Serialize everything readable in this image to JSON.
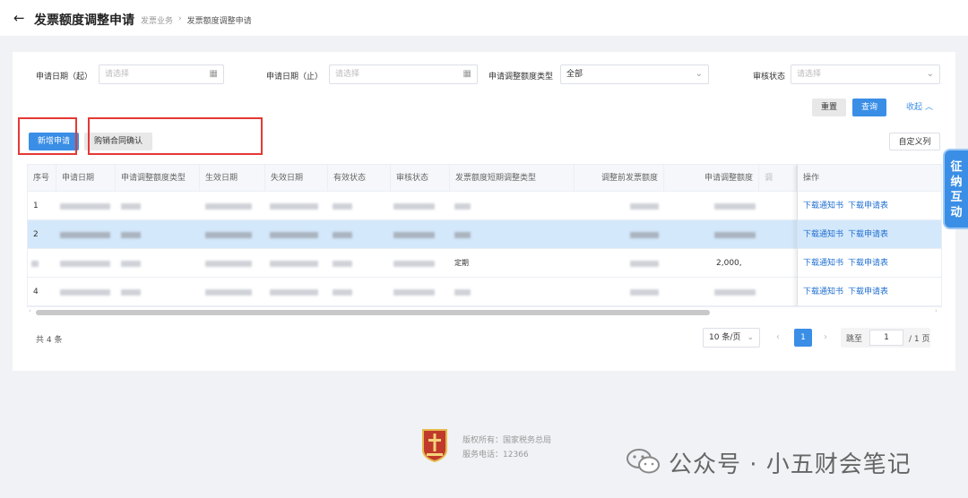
{
  "header": {
    "back_icon": "arrow-left-icon",
    "title": "发票额度调整申请",
    "breadcrumb": [
      "发票业务",
      "发票额度调整申请"
    ],
    "breadcrumb_sep": "›"
  },
  "filters": {
    "start_date": {
      "label": "申请日期（起）",
      "placeholder": "请选择"
    },
    "end_date": {
      "label": "申请日期（止）",
      "placeholder": "请选择"
    },
    "adjust_type": {
      "label": "申请调整额度类型",
      "value": "全部"
    },
    "review_status": {
      "label": "审核状态",
      "placeholder": "请选择"
    },
    "reset": "重置",
    "query": "查询",
    "collapse": "收起"
  },
  "toolbar": {
    "new_application": "新增申请",
    "contract_confirm": "购销合同确认",
    "custom_columns": "自定义列"
  },
  "table": {
    "columns": [
      "序号",
      "申请日期",
      "申请调整额度类型",
      "生效日期",
      "失效日期",
      "有效状态",
      "审核状态",
      "发票额度短期调整类型",
      "调整前发票额度",
      "申请调整额度",
      "调",
      "操作"
    ],
    "rows": [
      {
        "index": "1",
        "note": "",
        "amount": ""
      },
      {
        "index": "2",
        "note": "",
        "amount": ""
      },
      {
        "index": "",
        "note": "定期",
        "amount": "2,000,"
      },
      {
        "index": "4",
        "note": "",
        "amount": ""
      }
    ],
    "actions": {
      "notice": "下载通知书",
      "form": "下载申请表"
    },
    "selected_row": 2
  },
  "pagination": {
    "total": "共 4 条",
    "page_size": "10 条/页",
    "current_page": "1",
    "jump_label": "跳至",
    "jump_value": "1",
    "total_pages": "/ 1 页"
  },
  "side_tab": {
    "lines": [
      "征",
      "纳",
      "互",
      "动"
    ]
  },
  "footer": {
    "copyright": "版权所有：国家税务总局",
    "phone": "服务电话：12366"
  },
  "watermark": "公众号 · 小五财会笔记",
  "colors": {
    "primary": "#3a8ee6",
    "highlight_border": "#e53935",
    "selected_row": "#d4e8fb"
  }
}
